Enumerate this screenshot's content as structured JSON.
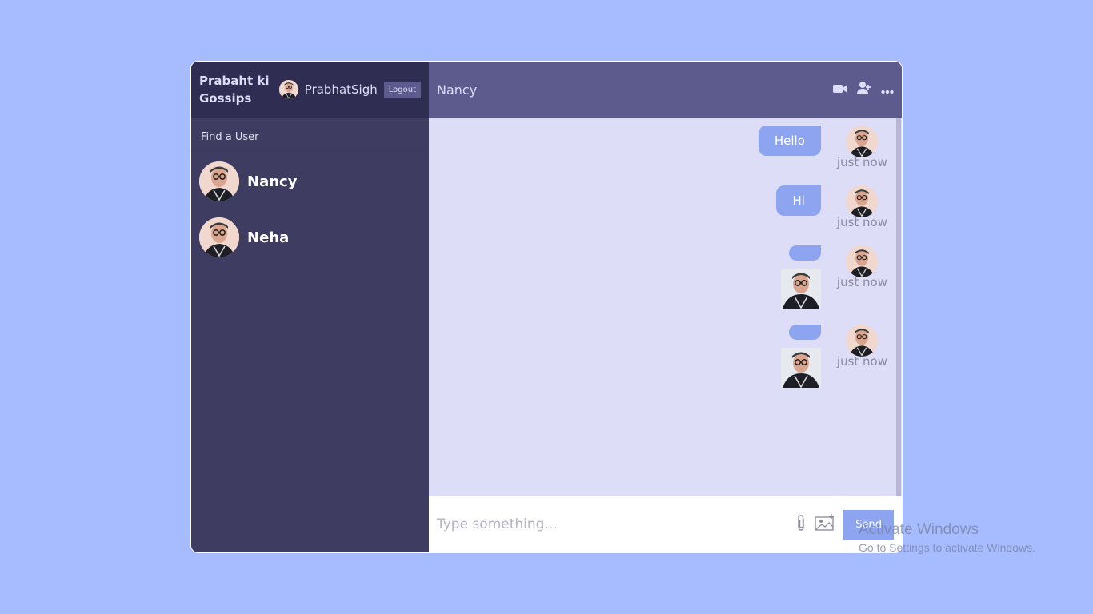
{
  "sidebar": {
    "logo": "Prabaht ki Gossips",
    "current_user": {
      "name": "PrabhatSigh"
    },
    "logout_label": "Logout",
    "search_placeholder": "Find a User",
    "chats": [
      {
        "name": "Nancy"
      },
      {
        "name": "Neha"
      }
    ]
  },
  "chat": {
    "title": "Nancy",
    "icons": [
      "video-camera-icon",
      "add-user-icon",
      "more-icon"
    ],
    "messages": [
      {
        "text": "Hello",
        "time": "just now",
        "has_image": false
      },
      {
        "text": "Hi",
        "time": "just now",
        "has_image": false
      },
      {
        "text": "",
        "time": "just now",
        "has_image": true
      },
      {
        "text": "",
        "time": "just now",
        "has_image": true
      }
    ],
    "input": {
      "placeholder": "Type something...",
      "send_label": "Send",
      "icons": [
        "attach-icon",
        "image-icon"
      ]
    }
  },
  "watermark": {
    "title": "Activate Windows",
    "subtitle": "Go to Settings to activate Windows."
  },
  "colors": {
    "background": "#a7bcff",
    "sidebar": "#3e3c61",
    "navbar": "#2f2d52",
    "chat_header": "#5d5b8d",
    "chat_bg": "#ddddf7",
    "bubble": "#8da4f1"
  }
}
